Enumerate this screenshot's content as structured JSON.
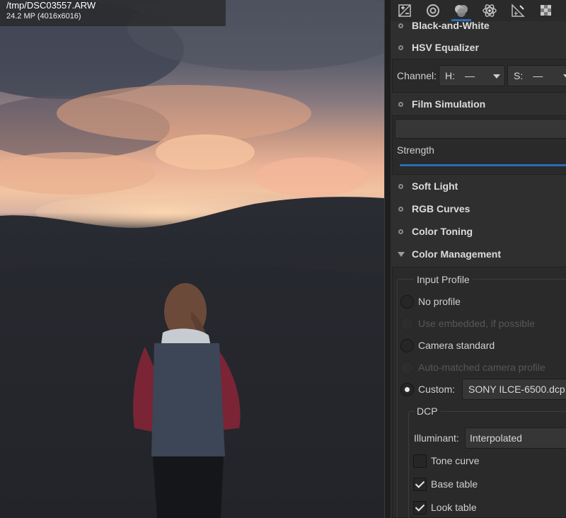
{
  "preview": {
    "file_name": "/tmp/DSC03557.ARW",
    "file_dims": "24.2 MP (4016x6016)"
  },
  "toolbar": {
    "tabs": [
      {
        "icon": "exposure-icon",
        "active": false
      },
      {
        "icon": "detail-icon",
        "active": false
      },
      {
        "icon": "color-icon",
        "active": true
      },
      {
        "icon": "advanced-icon",
        "active": false
      },
      {
        "icon": "transform-icon",
        "active": false
      },
      {
        "icon": "raw-icon",
        "active": false
      }
    ],
    "accent": "#2b6cb8"
  },
  "sections": {
    "black_and_white": "Black-and-White",
    "hsv_equalizer": "HSV Equalizer",
    "film_simulation": "Film Simulation",
    "soft_light": "Soft Light",
    "rgb_curves": "RGB Curves",
    "color_toning": "Color Toning",
    "color_management": "Color Management"
  },
  "hsv": {
    "channel_label": "Channel:",
    "h_label": "H:",
    "h_value": "—",
    "s_label": "S:",
    "s_value": "—"
  },
  "film": {
    "strength_label": "Strength"
  },
  "input_profile": {
    "title": "Input Profile",
    "options": {
      "no_profile": "No profile",
      "use_embedded": "Use embedded, if possible",
      "camera_standard": "Camera standard",
      "auto_matched": "Auto-matched camera profile",
      "custom": "Custom:"
    },
    "selected": "custom",
    "custom_value": "SONY ILCE-6500.dcp"
  },
  "dcp": {
    "title": "DCP",
    "illuminant_label": "Illuminant:",
    "illuminant_value": "Interpolated",
    "tone_curve": "Tone curve",
    "tone_curve_checked": false,
    "base_table": "Base table",
    "base_table_checked": true,
    "look_table": "Look table",
    "look_table_checked": true
  }
}
